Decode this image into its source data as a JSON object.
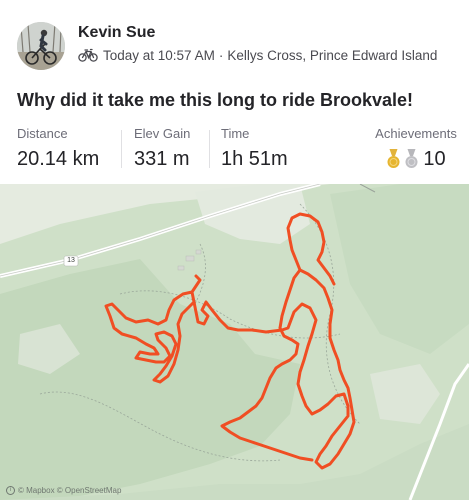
{
  "athlete": {
    "name": "Kevin Sue",
    "timestamp": "Today at 10:57 AM",
    "location": "Kellys Cross, Prince Edward Island",
    "separator": "·"
  },
  "activity": {
    "title": "Why did it take me this long to ride Brookvale!",
    "type_icon": "bike-icon"
  },
  "stats": {
    "distance": {
      "label": "Distance",
      "value": "20.14 km"
    },
    "elev_gain": {
      "label": "Elev Gain",
      "value": "331 m"
    },
    "time": {
      "label": "Time",
      "value": "1h 51m"
    },
    "achievements": {
      "label": "Achievements",
      "count": "10",
      "medal_icons": [
        "gold-medal-icon",
        "silver-medal-icon"
      ]
    }
  },
  "map": {
    "road_shield": "13",
    "attribution": "© Mapbox © OpenStreetMap",
    "route_color": "#f04e23",
    "forest_color": "#c9dbc3",
    "background_color": "#e5ebe0"
  }
}
